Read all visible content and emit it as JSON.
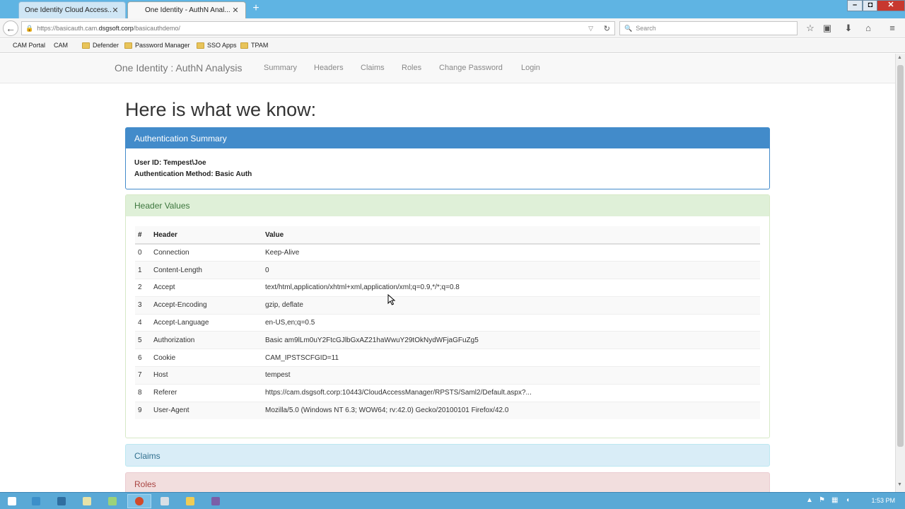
{
  "browser": {
    "tabs": [
      {
        "label": "One Identity Cloud Access...",
        "active": false
      },
      {
        "label": "One Identity - AuthN Anal...",
        "active": true
      }
    ],
    "new_tab_label": "+",
    "window_buttons": {
      "minimize": "–",
      "maximize": "◘",
      "close": "✕"
    },
    "url": {
      "prefix": "https://basicauth.cam.",
      "domain": "dsgsoft.corp",
      "path": "/basicauthdemo/"
    },
    "search_placeholder": "Search",
    "bookmarks": [
      "CAM Portal",
      "CAM",
      "Defender",
      "Password Manager",
      "SSO Apps",
      "TPAM"
    ]
  },
  "site": {
    "brand": "One Identity : AuthN Analysis",
    "nav": [
      "Summary",
      "Headers",
      "Claims",
      "Roles",
      "Change Password",
      "Login"
    ]
  },
  "page": {
    "heading": "Here is what we know:",
    "auth_panel": {
      "title": "Authentication Summary",
      "user_id": "User ID: Tempest\\Joe",
      "method": "Authentication Method: Basic Auth"
    },
    "header_panel": {
      "title": "Header Values",
      "columns": [
        "#",
        "Header",
        "Value"
      ],
      "rows": [
        {
          "num": "0",
          "header": "Connection",
          "value": "Keep-Alive"
        },
        {
          "num": "1",
          "header": "Content-Length",
          "value": "0"
        },
        {
          "num": "2",
          "header": "Accept",
          "value": "text/html,application/xhtml+xml,application/xml;q=0.9,*/*;q=0.8"
        },
        {
          "num": "3",
          "header": "Accept-Encoding",
          "value": "gzip, deflate"
        },
        {
          "num": "4",
          "header": "Accept-Language",
          "value": "en-US,en;q=0.5"
        },
        {
          "num": "5",
          "header": "Authorization",
          "value": "Basic am9lLm0uY2FtcGJlbGxAZ21haWwuY29tOkNydWFjaGFuZg5"
        },
        {
          "num": "6",
          "header": "Cookie",
          "value": "CAM_IPSTSCFGID=11"
        },
        {
          "num": "7",
          "header": "Host",
          "value": "tempest"
        },
        {
          "num": "8",
          "header": "Referer",
          "value": "https://cam.dsgsoft.corp:10443/CloudAccessManager/RPSTS/Saml2/Default.aspx?..."
        },
        {
          "num": "9",
          "header": "User-Agent",
          "value": "Mozilla/5.0 (Windows NT 6.3; WOW64; rv:42.0) Gecko/20100101 Firefox/42.0"
        }
      ]
    },
    "claims_panel": {
      "title": "Claims"
    },
    "roles_panel": {
      "title": "Roles"
    }
  },
  "taskbar": {
    "clock": "1:53 PM",
    "items": [
      {
        "icon": "windows-start-icon",
        "color": "#ffffff"
      },
      {
        "icon": "file-explorer-icon",
        "color": "#3c8fc9"
      },
      {
        "icon": "server-manager-icon",
        "color": "#2f6ea0"
      },
      {
        "icon": "powershell-icon",
        "color": "#e7e2a8"
      },
      {
        "icon": "ie-icon",
        "color": "#9bd27a"
      },
      {
        "icon": "firefox-icon",
        "color": "#d24a2a"
      },
      {
        "icon": "notepad-icon",
        "color": "#d9dfe5"
      },
      {
        "icon": "folder-icon",
        "color": "#f0cc55"
      },
      {
        "icon": "app-icon",
        "color": "#7a5fa8"
      }
    ]
  }
}
